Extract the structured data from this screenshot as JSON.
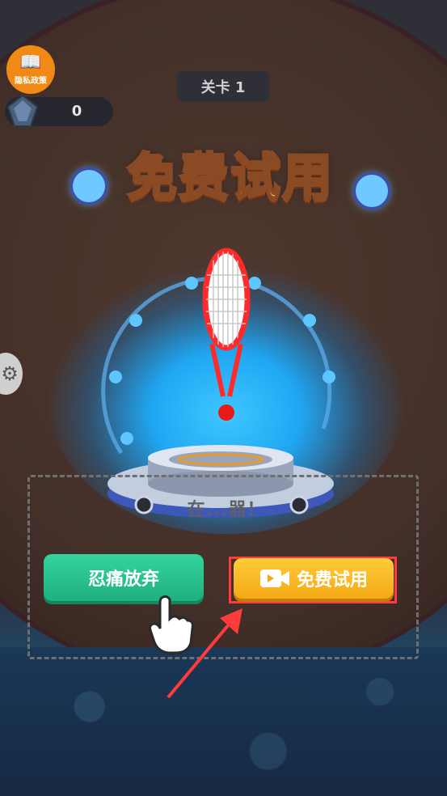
{
  "hud": {
    "privacy_label": "隐私政策",
    "privacy_icon": "privacy-shield-book-icon",
    "gem_count": "0",
    "gem_icon": "gem-icon",
    "level_text": "关卡 1"
  },
  "popup": {
    "title": "免费试用",
    "item_icon": "tennis-racket-icon",
    "hint_text": "在...器！",
    "give_up_label": "忍痛放弃",
    "free_trial_label": "免费试用",
    "free_trial_icon": "video-camera-icon"
  },
  "colors": {
    "accent_gold": "#f5a915",
    "accent_green": "#1fb07e",
    "highlight_red": "#ff3b3b",
    "glow_blue": "#1fa6f2"
  }
}
